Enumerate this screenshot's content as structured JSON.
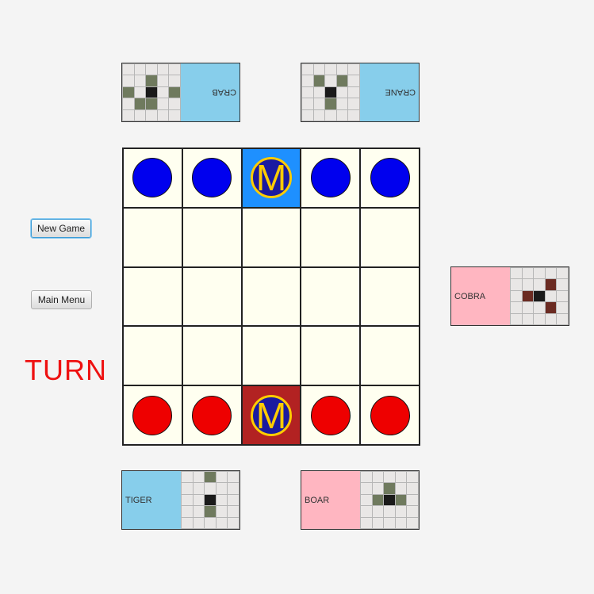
{
  "controls": {
    "new_game_label": "New Game",
    "main_menu_label": "Main Menu"
  },
  "turn_label": "TURN",
  "turn_color": "#ee1111",
  "master_letter": "M",
  "cards": {
    "top_left": {
      "name": "CRAB",
      "orientation": "flipped",
      "side_color": "#87ceeb",
      "moves": [
        [
          2,
          0
        ],
        [
          3,
          1
        ],
        [
          2,
          4
        ],
        [
          1,
          2
        ],
        [
          3,
          2
        ]
      ]
    },
    "top_right": {
      "name": "CRANE",
      "orientation": "flipped",
      "side_color": "#87ceeb",
      "moves": [
        [
          1,
          1
        ],
        [
          1,
          3
        ],
        [
          2,
          2
        ],
        [
          3,
          2
        ]
      ]
    },
    "side": {
      "name": "COBRA",
      "orientation": "upright",
      "side_color": "#ffb6c1",
      "moves": [
        [
          1,
          3
        ],
        [
          2,
          1
        ],
        [
          3,
          3
        ]
      ]
    },
    "bottom_left": {
      "name": "TIGER",
      "orientation": "upright",
      "side_color": "#87ceeb",
      "moves": [
        [
          0,
          2
        ],
        [
          2,
          2
        ],
        [
          3,
          2
        ]
      ]
    },
    "bottom_right": {
      "name": "BOAR",
      "orientation": "upright",
      "side_color": "#ffb6c1",
      "moves": [
        [
          1,
          2
        ],
        [
          2,
          1
        ],
        [
          2,
          3
        ]
      ]
    }
  },
  "board": {
    "rows": [
      [
        "blue-pawn",
        "blue-pawn",
        "blue-master",
        "blue-pawn",
        "blue-pawn"
      ],
      [
        "",
        "",
        "",
        "",
        ""
      ],
      [
        "",
        "",
        "",
        "",
        ""
      ],
      [
        "",
        "",
        "",
        "",
        ""
      ],
      [
        "red-pawn",
        "red-pawn",
        "red-master",
        "red-pawn",
        "red-pawn"
      ]
    ]
  }
}
